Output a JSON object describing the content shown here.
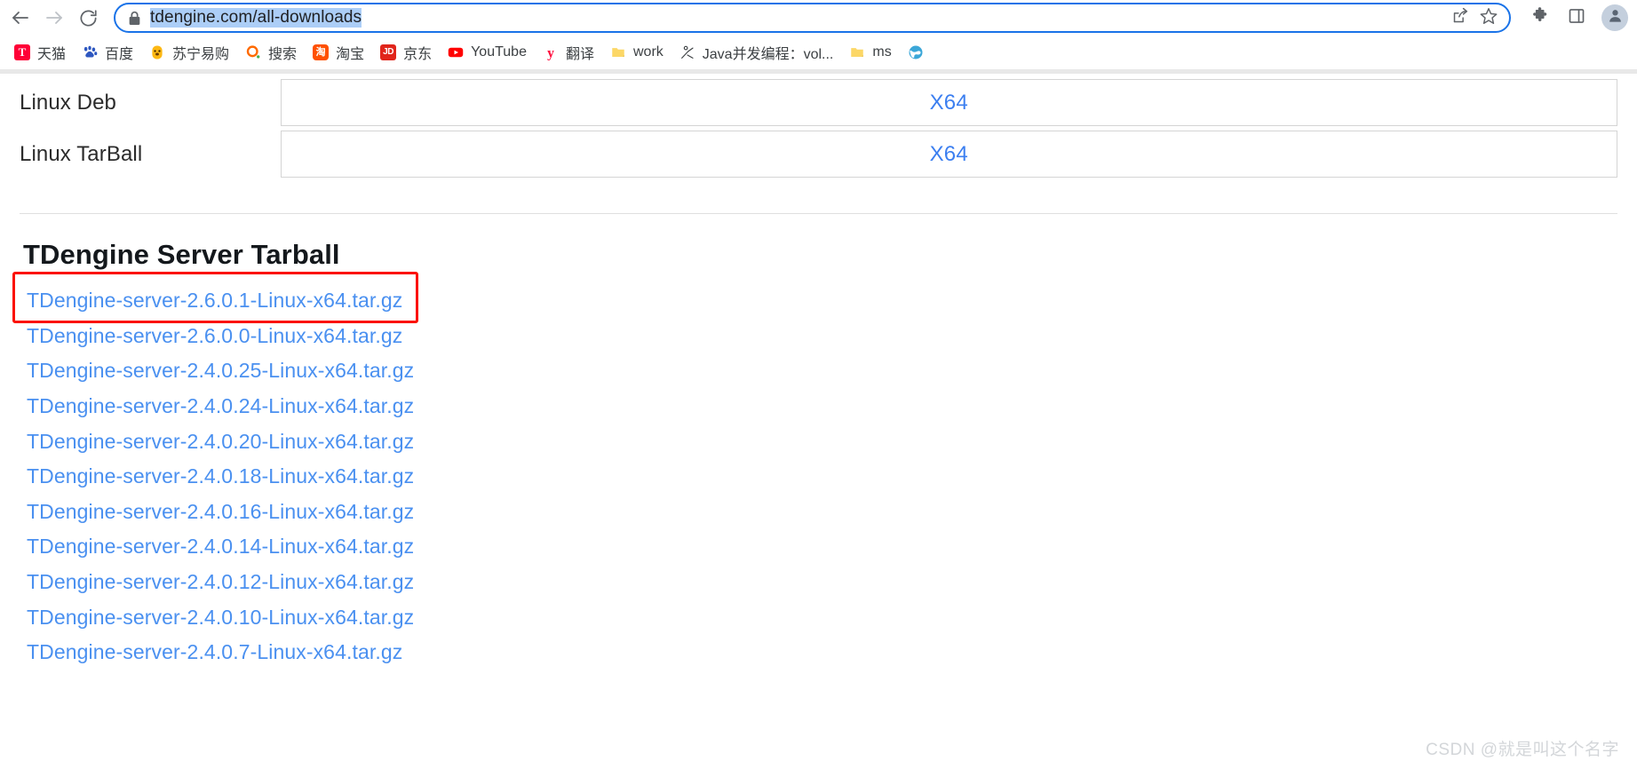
{
  "browser": {
    "back_icon": "back-arrow-icon",
    "forward_icon": "forward-arrow-icon",
    "reload_icon": "reload-icon",
    "lock_icon": "lock-icon",
    "url": "tdengine.com/all-downloads",
    "url_selected": true,
    "share_icon": "share-icon",
    "bookmark_star_icon": "star-icon",
    "extensions_icon": "puzzle-piece-icon",
    "side_panel_icon": "side-panel-icon",
    "profile_icon": "avatar-icon"
  },
  "bookmarks": [
    {
      "label": "天猫",
      "icon": "tmall-favicon"
    },
    {
      "label": "百度",
      "icon": "baidu-favicon"
    },
    {
      "label": "苏宁易购",
      "icon": "suning-favicon"
    },
    {
      "label": "搜索",
      "icon": "search-favicon"
    },
    {
      "label": "淘宝",
      "icon": "taobao-favicon"
    },
    {
      "label": "京东",
      "icon": "jd-favicon"
    },
    {
      "label": "YouTube",
      "icon": "youtube-favicon"
    },
    {
      "label": "翻译",
      "icon": "translate-favicon"
    },
    {
      "label": "work",
      "icon": "folder-icon"
    },
    {
      "label": "Java并发编程：vol...",
      "icon": "generic-favicon"
    },
    {
      "label": "ms",
      "icon": "folder-icon"
    },
    {
      "label": "",
      "icon": "globe-icon"
    }
  ],
  "page": {
    "os_table": {
      "rows": [
        {
          "os": "Linux Deb",
          "arch": "X64"
        },
        {
          "os": "Linux TarBall",
          "arch": "X64"
        }
      ]
    },
    "section_title": "TDengine Server Tarball",
    "tarballs": [
      {
        "name": "TDengine-server-2.6.0.1-Linux-x64.tar.gz",
        "highlighted": true
      },
      {
        "name": "TDengine-server-2.6.0.0-Linux-x64.tar.gz",
        "highlighted": false
      },
      {
        "name": "TDengine-server-2.4.0.25-Linux-x64.tar.gz",
        "highlighted": false
      },
      {
        "name": "TDengine-server-2.4.0.24-Linux-x64.tar.gz",
        "highlighted": false
      },
      {
        "name": "TDengine-server-2.4.0.20-Linux-x64.tar.gz",
        "highlighted": false
      },
      {
        "name": "TDengine-server-2.4.0.18-Linux-x64.tar.gz",
        "highlighted": false
      },
      {
        "name": "TDengine-server-2.4.0.16-Linux-x64.tar.gz",
        "highlighted": false
      },
      {
        "name": "TDengine-server-2.4.0.14-Linux-x64.tar.gz",
        "highlighted": false
      },
      {
        "name": "TDengine-server-2.4.0.12-Linux-x64.tar.gz",
        "highlighted": false
      },
      {
        "name": "TDengine-server-2.4.0.10-Linux-x64.tar.gz",
        "highlighted": false
      },
      {
        "name": "TDengine-server-2.4.0.7-Linux-x64.tar.gz",
        "highlighted": false
      }
    ],
    "watermark": "CSDN @就是叫这个名字"
  },
  "colors": {
    "link_blue": "#4a90f0",
    "arch_blue": "#3c7ff0",
    "omnibox_focus": "#1a73e8",
    "url_selection": "#accef7",
    "highlight_box": "#fb1202",
    "watermark": "#d3d6d9"
  }
}
